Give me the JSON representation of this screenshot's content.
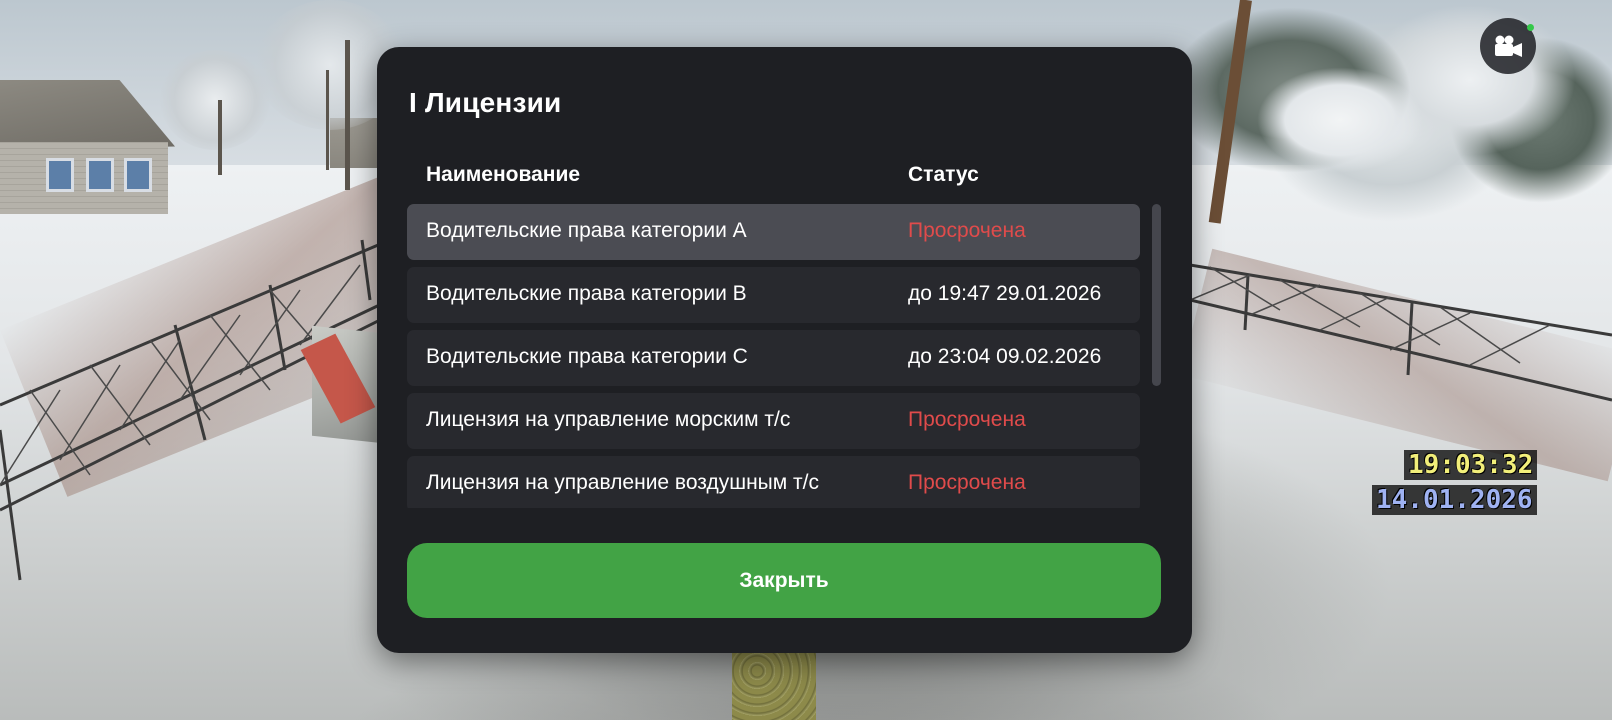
{
  "hud": {
    "time": "19:03:32",
    "date": "14.01.2026",
    "record_icon": "video-camera-icon"
  },
  "dialog": {
    "title": "I Лицензии",
    "columns": {
      "name": "Наименование",
      "status": "Статус"
    },
    "rows": [
      {
        "name": "Водительские права категории А",
        "status": "Просрочена",
        "expired": true,
        "selected": true
      },
      {
        "name": "Водительские права категории B",
        "status": "до 19:47 29.01.2026",
        "expired": false,
        "selected": false
      },
      {
        "name": "Водительские права категории C",
        "status": "до 23:04 09.02.2026",
        "expired": false,
        "selected": false
      },
      {
        "name": "Лицензия на управление морским т/с",
        "status": "Просрочена",
        "expired": true,
        "selected": false
      },
      {
        "name": "Лицензия на управление воздушным т/с",
        "status": "Просрочена",
        "expired": true,
        "selected": false
      }
    ],
    "close_label": "Закрыть"
  },
  "colors": {
    "dialog_bg": "#1e1f23",
    "row_bg": "#28292e",
    "row_selected_bg": "#4b4c53",
    "expired_text": "#e04b4b",
    "close_button": "#42a345"
  }
}
